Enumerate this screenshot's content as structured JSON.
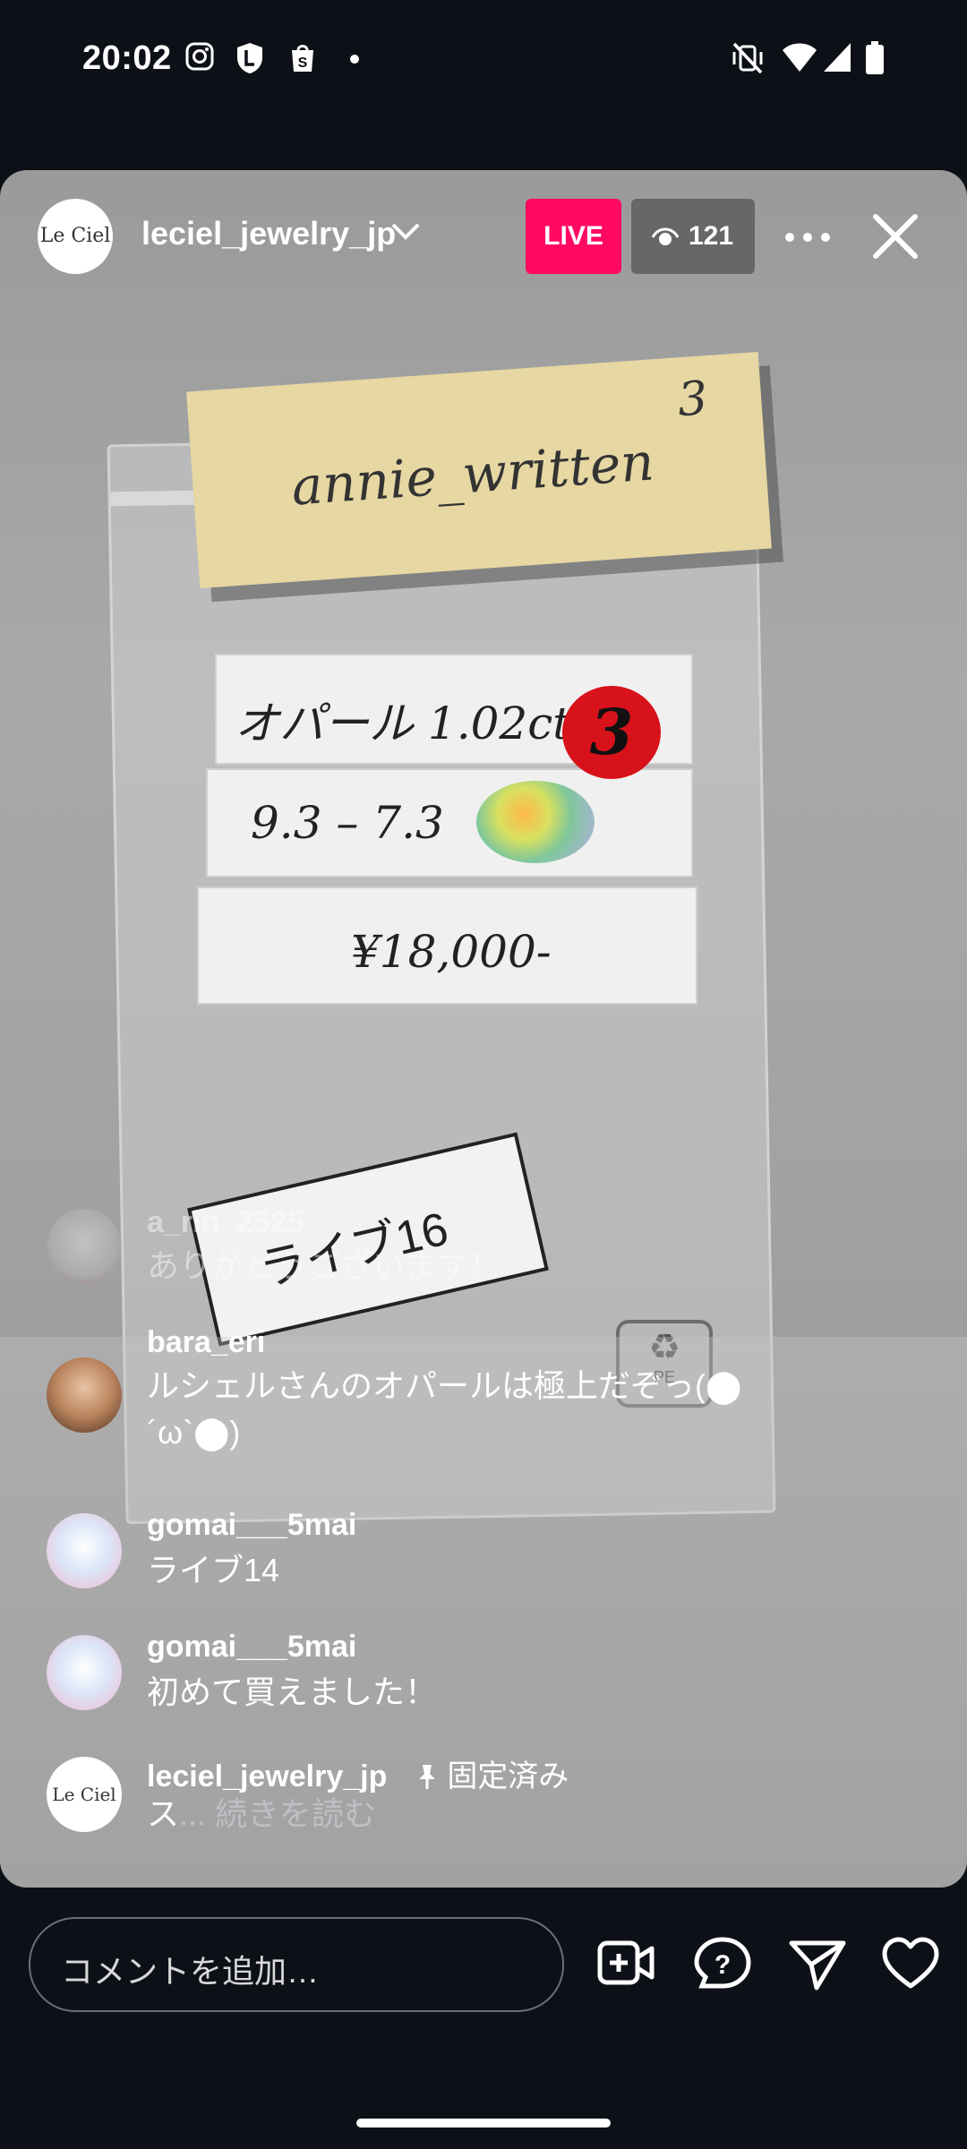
{
  "status_bar": {
    "time": "20:02",
    "left_icons": [
      "instagram-icon",
      "shield-l-icon",
      "shopify-bag-icon",
      "dot-icon"
    ],
    "right_icons": [
      "vibrate-off-icon",
      "wifi-icon",
      "signal-icon",
      "battery-icon"
    ]
  },
  "live": {
    "host": {
      "username": "leciel_jewelry_jp",
      "avatar_text": "Le Ciel"
    },
    "live_label": "LIVE",
    "viewer_count": "121"
  },
  "video_text": {
    "sticky_note": "annie_written",
    "sticky_number": "3",
    "card_1": "オパール 1.02ct",
    "card_2": "9.3 – 7.3",
    "card_3": "¥18,000-",
    "red_circle": "3",
    "tag": "ライブ16",
    "recycle_mark": "PE"
  },
  "comments": [
    {
      "username": "a_rin_2525",
      "text": "ありがとうございます！",
      "faded": true
    },
    {
      "username": "bara_eri",
      "text": "ルシェルさんのオパールは極上だぞっ(⬤´ω`⬤)"
    },
    {
      "username": "gomai___5mai",
      "text": "ライブ14"
    },
    {
      "username": "gomai___5mai",
      "text": "初めて買えました！"
    },
    {
      "username": "leciel_jewelry_jp",
      "pinned_label": "固定済み",
      "text": "ス",
      "more_label": "... 続きを読む"
    }
  ],
  "comment_bar": {
    "placeholder": "コメントを追加…",
    "icons": [
      "add-video-icon",
      "question-icon",
      "send-icon",
      "heart-icon"
    ]
  },
  "colors": {
    "live_badge": "#ff0a62",
    "background": "#0d1117"
  }
}
